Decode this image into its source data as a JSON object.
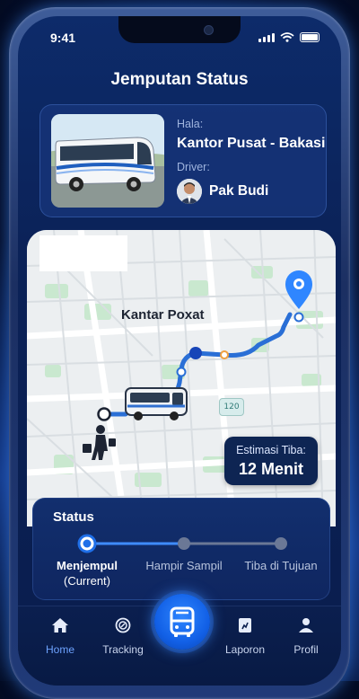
{
  "status_bar": {
    "time": "9:41"
  },
  "header": {
    "title": "Jemputan Status"
  },
  "info_card": {
    "destination_label": "Hala:",
    "destination": "Kantor Pusat - Bakasi",
    "driver_label": "Driver:",
    "driver_name": "Pak Budi"
  },
  "map": {
    "place_label": "Kantar Poxat",
    "road_badge": "120",
    "eta_label": "Estimasi Tiba:",
    "eta_value": "12 Menit"
  },
  "status": {
    "title": "Status",
    "steps": [
      {
        "label": "Menjempul",
        "sublabel": "(Current)",
        "active": true
      },
      {
        "label": "Hampir Sampil",
        "active": false
      },
      {
        "label": "Tiba di Tujuan",
        "active": false
      }
    ]
  },
  "nav": {
    "items": [
      {
        "label": "Home",
        "icon": "home-icon",
        "active": true
      },
      {
        "label": "Tracking",
        "icon": "tracking-icon",
        "active": false
      },
      {
        "label": "",
        "icon": "bus-icon",
        "active": false
      },
      {
        "label": "Laporon",
        "icon": "report-icon",
        "active": false
      },
      {
        "label": "Profil",
        "icon": "profile-icon",
        "active": false
      }
    ]
  },
  "colors": {
    "accent": "#2f86ff",
    "route": "#2a6fd6",
    "panel": "#0f2660"
  }
}
